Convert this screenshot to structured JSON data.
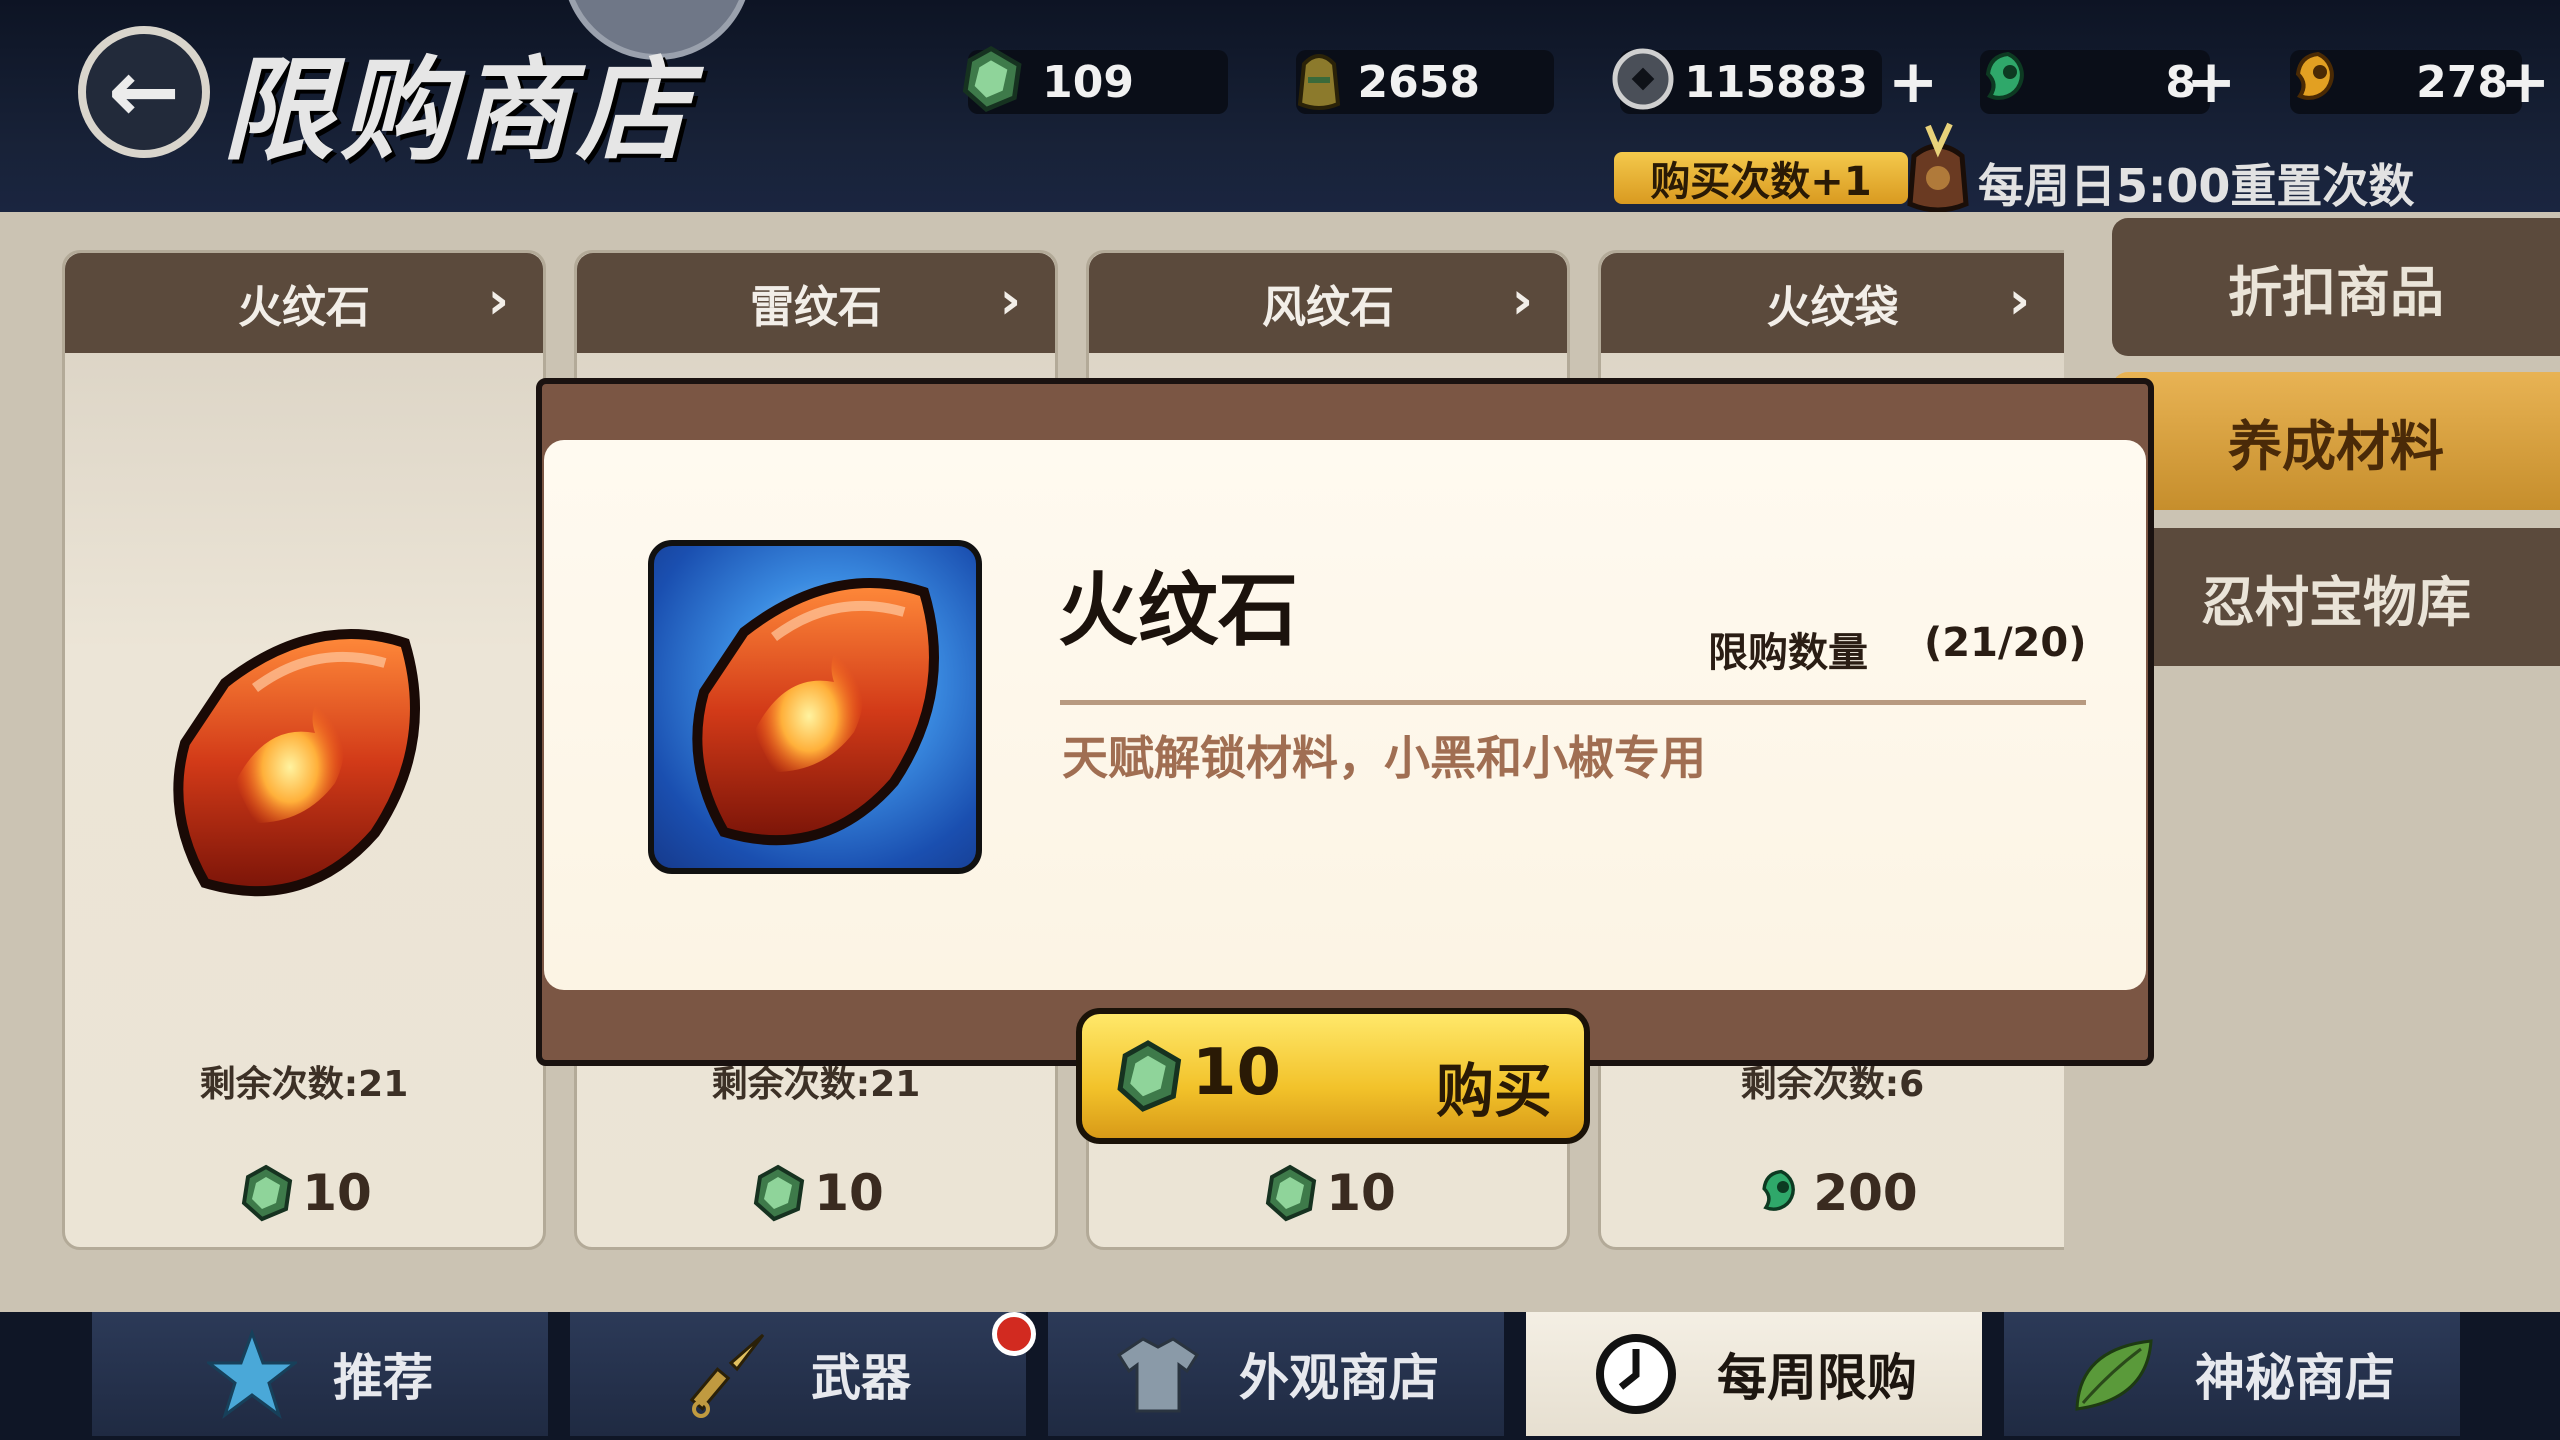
{
  "header": {
    "title": "限购商店",
    "buy_bonus": "购买次数+1",
    "reset_notice": "每周日5:00重置次数"
  },
  "currencies": [
    {
      "name": "jade",
      "value": "109",
      "has_plus": false
    },
    {
      "name": "scroll",
      "value": "2658",
      "has_plus": false
    },
    {
      "name": "coin",
      "value": "115883",
      "has_plus": true
    },
    {
      "name": "green-magatama",
      "value": "8",
      "has_plus": true
    },
    {
      "name": "gold-magatama",
      "value": "278",
      "has_plus": true
    }
  ],
  "cards": [
    {
      "title": "火纹石",
      "remaining": "剩余次数:21",
      "price": "10",
      "price_icon": "jade"
    },
    {
      "title": "雷纹石",
      "remaining": "剩余次数:21",
      "price": "10",
      "price_icon": "jade"
    },
    {
      "title": "风纹石",
      "remaining": "",
      "price": "10",
      "price_icon": "jade"
    },
    {
      "title": "火纹袋",
      "remaining": "剩余次数:6",
      "price": "200",
      "price_icon": "green-magatama"
    }
  ],
  "side_tabs": [
    {
      "label": "折扣商品",
      "active": false
    },
    {
      "label": "养成材料",
      "active": true
    },
    {
      "label": "忍村宝物库",
      "active": false
    }
  ],
  "modal": {
    "item_name": "火纹石",
    "limit_label": "限购数量",
    "limit_value": "(21/20)",
    "description": "天赋解锁材料，小黑和小椒专用",
    "buy_price": "10",
    "buy_label": "购买"
  },
  "bottom_nav": [
    {
      "label": "推荐",
      "icon": "star-icon",
      "active": false
    },
    {
      "label": "武器",
      "icon": "kunai-icon",
      "active": false,
      "badge": true
    },
    {
      "label": "外观商店",
      "icon": "shirt-icon",
      "active": false
    },
    {
      "label": "每周限购",
      "icon": "clock-icon",
      "active": true
    },
    {
      "label": "神秘商店",
      "icon": "leaf-icon",
      "active": false
    }
  ],
  "colors": {
    "panel_brown": "#5b4a3c",
    "gold_accent": "#f2c22a",
    "modal_frame": "#7b5644",
    "description_text": "#a06e52"
  }
}
